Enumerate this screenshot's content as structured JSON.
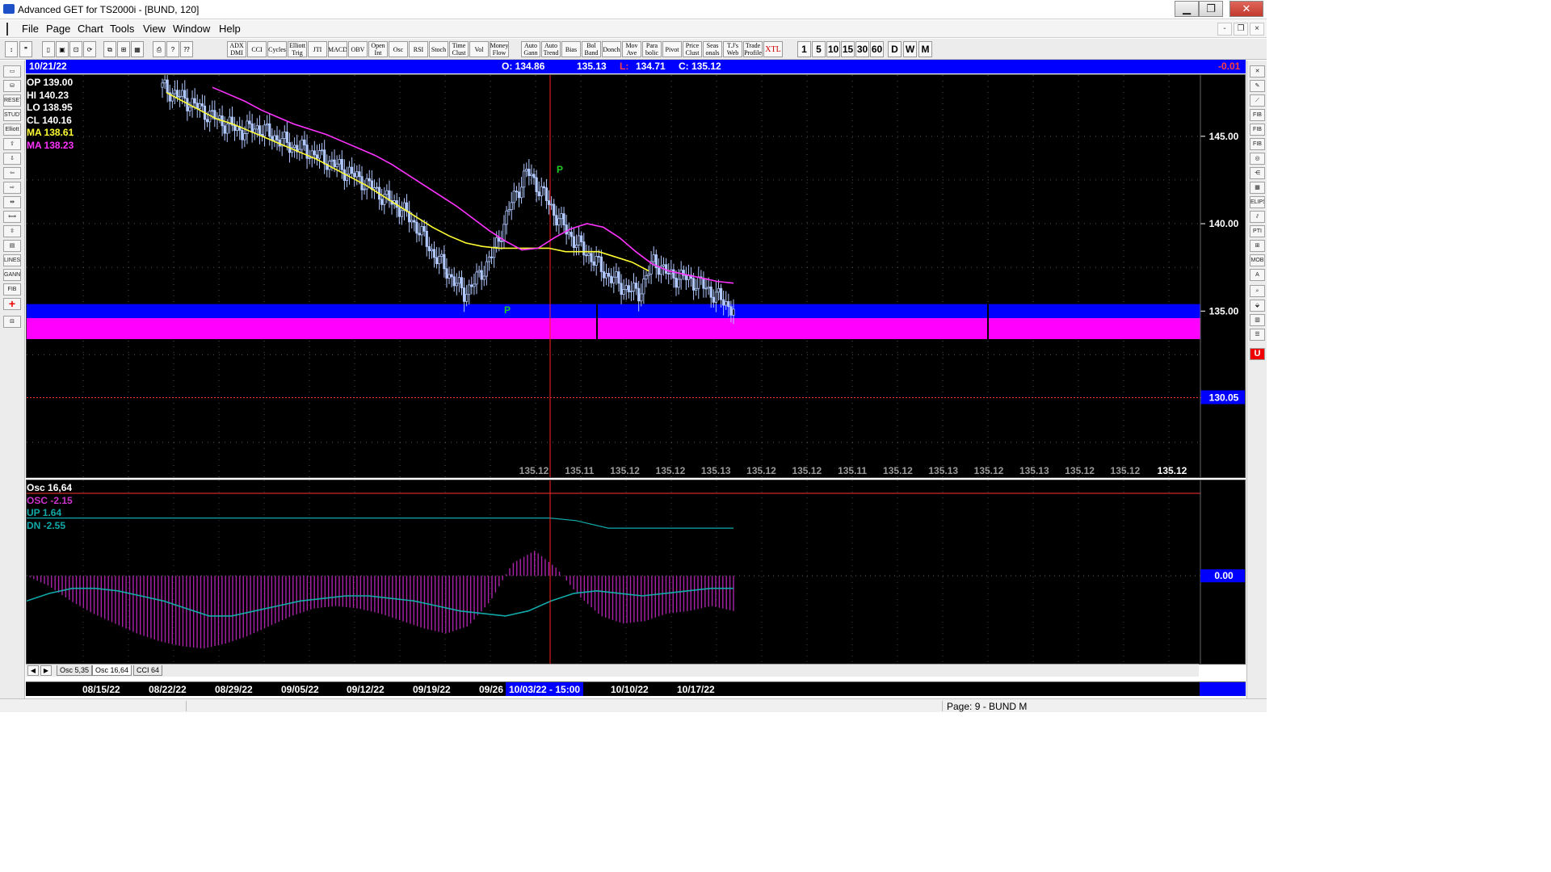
{
  "window": {
    "title": "Advanced GET for TS2000i - [BUND, 120]",
    "minimize_label": "▁",
    "maximize_label": "❐",
    "close_label": "✕"
  },
  "menubar": {
    "items": [
      "File",
      "Page",
      "Chart",
      "Tools",
      "View",
      "Window",
      "Help"
    ],
    "mdi_min": "-",
    "mdi_restore": "❐",
    "mdi_close": "×"
  },
  "toolbar": {
    "indicators": [
      "ADX DMI",
      "CCI",
      "Cycles",
      "Elliott Trig",
      "JTI",
      "MACD",
      "OBV",
      "Open Int",
      "Osc",
      "RSI",
      "Stoch",
      "Time Clust",
      "Vol",
      "Money Flow"
    ],
    "studies": [
      "Auto Gann",
      "Auto Trend",
      "Bias",
      "Bol Band",
      "Donch",
      "Mov Ave",
      "Para bolic",
      "Pivot",
      "Price Clust",
      "Seas onals",
      "T.J's Web",
      "Trade Profile",
      "XTL"
    ],
    "timeframes": [
      "1",
      "5",
      "10",
      "15",
      "30",
      "60",
      "D",
      "W",
      "M"
    ]
  },
  "lefttools": [
    "RESET",
    "STUDY",
    "Elliott",
    "LINES",
    "GANN",
    "FIB"
  ],
  "righttools": [
    "FIB RET",
    "FIB EXT",
    "FIB TIME",
    "ELIPS",
    "PTI",
    "MOB",
    "A"
  ],
  "infobar": {
    "date": "10/21/22",
    "open": "O: 134.86",
    "high": "135.13",
    "low_label": "L:",
    "low": "134.71",
    "close": "C: 135.12",
    "change": "-0.01"
  },
  "price_legend": {
    "op": "OP  139.00",
    "hi": "HI   140.23",
    "lo": "LO   138.95",
    "cl": "CL   140.16",
    "ma1": "MA  138.61",
    "ma2": "MA  138.23"
  },
  "osc_legend": {
    "title": "Osc 16,64",
    "osc": "OSC -2.15",
    "up": "UP   1.64",
    "dn": "DN   -2.55"
  },
  "colors": {
    "background": "#000000",
    "candles": "#b0c8ff",
    "ma_fast": "#ffff33",
    "ma_slow": "#ff33ff",
    "zone_blue": "#0000ff",
    "zone_magenta": "#ff00ff",
    "pivot": "#22cc22",
    "osc_bars": "#aa22aa",
    "osc_bands": "#11aaaa",
    "cursor": "#ff2222"
  },
  "chart_data": {
    "type": "candlestick",
    "title": "",
    "y_axis_labels": [
      "145.00",
      "140.00",
      "135.00",
      "130.05"
    ],
    "ylim": [
      125.5,
      148.5
    ],
    "x_tick_labels": [
      "08/15/22",
      "08/22/22",
      "08/29/22",
      "09/05/22",
      "09/12/22",
      "09/19/22",
      "09/26",
      "10/10/22",
      "10/17/22"
    ],
    "cursor_label": "10/03/22 - 15:00",
    "bottom_value_labels": [
      "135.12",
      "135.11",
      "135.12",
      "135.12",
      "135.13",
      "135.12",
      "135.12",
      "135.11",
      "135.12",
      "135.13",
      "135.12",
      "135.13",
      "135.12",
      "135.12"
    ],
    "last_value_label": "135.12",
    "pivot_labels": [
      "P",
      "P"
    ],
    "pivots": [
      {
        "label": "P",
        "price": 143.5
      },
      {
        "label": "P",
        "price": 135.3
      }
    ],
    "support_zone_blue": [
      134.6,
      135.4
    ],
    "support_zone_magenta": [
      133.4,
      134.6
    ],
    "stop_line": 130.05,
    "close_series": [
      147.8,
      147.3,
      146.8,
      146.2,
      145.7,
      145.3,
      145.5,
      145.0,
      144.5,
      144.2,
      143.8,
      143.3,
      142.8,
      142.2,
      141.5,
      140.9,
      139.9,
      138.4,
      137.2,
      136.0,
      137.0,
      138.6,
      141.2,
      143.0,
      141.7,
      140.2,
      139.0,
      138.1,
      137.1,
      136.4,
      136.0,
      137.9,
      137.0,
      136.9,
      136.5,
      135.8,
      135.12
    ],
    "ma_fast_series": [
      147.5,
      147.0,
      146.5,
      146.0,
      145.7,
      145.3,
      144.9,
      144.5,
      144.1,
      143.7,
      143.2,
      142.7,
      142.2,
      141.6,
      141.0,
      140.4,
      139.8,
      139.3,
      138.9,
      138.7,
      138.6,
      138.6,
      138.6,
      138.6,
      138.4,
      138.4,
      138.4,
      138.1,
      137.8,
      137.3
    ],
    "ma_slow_series": [
      147.8,
      147.4,
      147.0,
      146.5,
      146.1,
      145.7,
      145.4,
      145.1,
      144.7,
      144.3,
      143.9,
      143.4,
      142.8,
      142.2,
      141.6,
      141.0,
      140.3,
      139.6,
      139.0,
      138.5,
      138.6,
      139.2,
      139.7,
      140.0,
      139.8,
      139.2,
      138.4,
      137.7,
      137.3,
      137.1,
      136.9,
      136.7,
      136.6
    ],
    "oscillator": {
      "right_label": "0.00",
      "osc_series": [
        0.0,
        -0.4,
        -1.0,
        -1.5,
        -1.9,
        -2.3,
        -2.6,
        -2.8,
        -2.9,
        -2.7,
        -2.4,
        -2.0,
        -1.6,
        -1.3,
        -1.2,
        -1.3,
        -1.5,
        -1.8,
        -2.1,
        -2.3,
        -2.0,
        -1.0,
        0.5,
        1.0,
        0.3,
        -0.8,
        -1.6,
        -1.9,
        -1.8,
        -1.5,
        -1.4,
        -1.2,
        -1.4
      ],
      "up_band": 1.64,
      "dn_band": -2.55
    }
  },
  "tabs": [
    "Osc 5,35",
    "Osc 16,64",
    "CCI 64"
  ],
  "tab_nav": [
    "◀",
    "▶"
  ],
  "statusbar": {
    "text": "Page: 9 - BUND M"
  }
}
